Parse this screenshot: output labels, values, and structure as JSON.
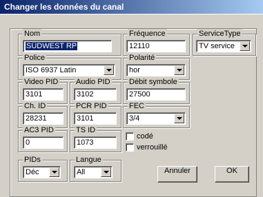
{
  "window": {
    "title": "Changer les données du canal"
  },
  "fields": {
    "nom": {
      "label": "Nom",
      "value": "SÜDWEST RP"
    },
    "frequence": {
      "label": "Fréquence",
      "value": "12110"
    },
    "service_type": {
      "label": "ServiceType",
      "value": "TV service"
    },
    "police": {
      "label": "Police",
      "value": "ISO 6937 Latin"
    },
    "polarite": {
      "label": "Polarité",
      "value": "hor"
    },
    "video_pid": {
      "label": "Video PID",
      "value": "3101"
    },
    "audio_pid": {
      "label": "Audio PID",
      "value": "3102"
    },
    "debit_symbole": {
      "label": "Débit symbole",
      "value": "27500"
    },
    "ch_id": {
      "label": "Ch. ID",
      "value": "28231"
    },
    "pcr_pid": {
      "label": "PCR PID",
      "value": "3101"
    },
    "fec": {
      "label": "FEC",
      "value": "3/4"
    },
    "ac3_pid": {
      "label": "AC3 PID",
      "value": "0"
    },
    "ts_id": {
      "label": "TS ID",
      "value": "1073"
    },
    "code": {
      "label": "codé",
      "checked": false
    },
    "verrouille": {
      "label": "verrouillé",
      "checked": false
    },
    "pids": {
      "label": "PIDs",
      "value": "Déc"
    },
    "langue": {
      "label": "Langue",
      "value": "All"
    }
  },
  "buttons": {
    "annuler": "Annuler",
    "ok": "OK"
  }
}
